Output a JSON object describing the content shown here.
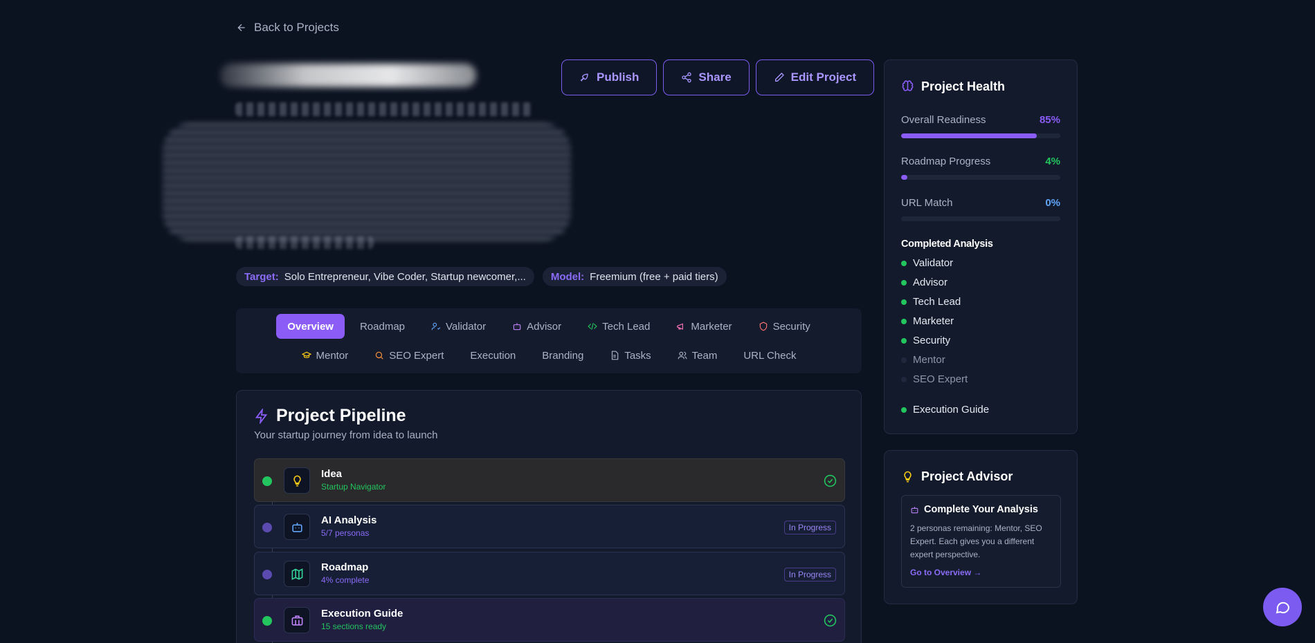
{
  "nav": {
    "back_label": "Back to Projects"
  },
  "actions": {
    "publish": "Publish",
    "share": "Share",
    "edit": "Edit Project"
  },
  "tags": [
    {
      "key": "Target:",
      "value": "Solo Entrepreneur, Vibe Coder, Startup newcomer,..."
    },
    {
      "key": "Model:",
      "value": "Freemium (free + paid tiers)"
    }
  ],
  "tabs": {
    "row1": [
      "Overview",
      "Roadmap",
      "Validator",
      "Advisor",
      "Tech Lead",
      "Marketer",
      "Security"
    ],
    "row2": [
      "Mentor",
      "SEO Expert",
      "Execution",
      "Branding",
      "Tasks",
      "Team",
      "URL Check"
    ],
    "active": "Overview"
  },
  "pipeline": {
    "title": "Project Pipeline",
    "subtitle": "Your startup journey from idea to launch",
    "stages": [
      {
        "name": "Idea",
        "status": "Startup Navigator",
        "state": "done"
      },
      {
        "name": "AI Analysis",
        "status": "5/7 personas",
        "state": "In Progress"
      },
      {
        "name": "Roadmap",
        "status": "4% complete",
        "state": "In Progress"
      },
      {
        "name": "Execution Guide",
        "status": "15 sections ready",
        "state": "done"
      }
    ]
  },
  "health": {
    "title": "Project Health",
    "metrics": [
      {
        "label": "Overall Readiness",
        "value": "85%",
        "fraction": 0.85,
        "color": "#8b5cf6"
      },
      {
        "label": "Roadmap Progress",
        "value": "4%",
        "fraction": 0.04,
        "color": "#22c55e"
      },
      {
        "label": "URL Match",
        "value": "0%",
        "fraction": 0.0,
        "color": "#60a5fa"
      }
    ],
    "completed_title": "Completed Analysis",
    "completed": [
      {
        "name": "Validator",
        "done": true
      },
      {
        "name": "Advisor",
        "done": true
      },
      {
        "name": "Tech Lead",
        "done": true
      },
      {
        "name": "Marketer",
        "done": true
      },
      {
        "name": "Security",
        "done": true
      },
      {
        "name": "Mentor",
        "done": false
      },
      {
        "name": "SEO Expert",
        "done": false
      },
      {
        "name": "Execution Guide",
        "done": true
      }
    ]
  },
  "advisor": {
    "title": "Project Advisor",
    "card_title": "Complete Your Analysis",
    "card_text": "2 personas remaining: Mentor, SEO Expert. Each gives you a different expert perspective.",
    "link": "Go to Overview →"
  },
  "colors": {
    "accent": "#8b5cf6",
    "success": "#22c55e",
    "background": "#0b1220"
  }
}
